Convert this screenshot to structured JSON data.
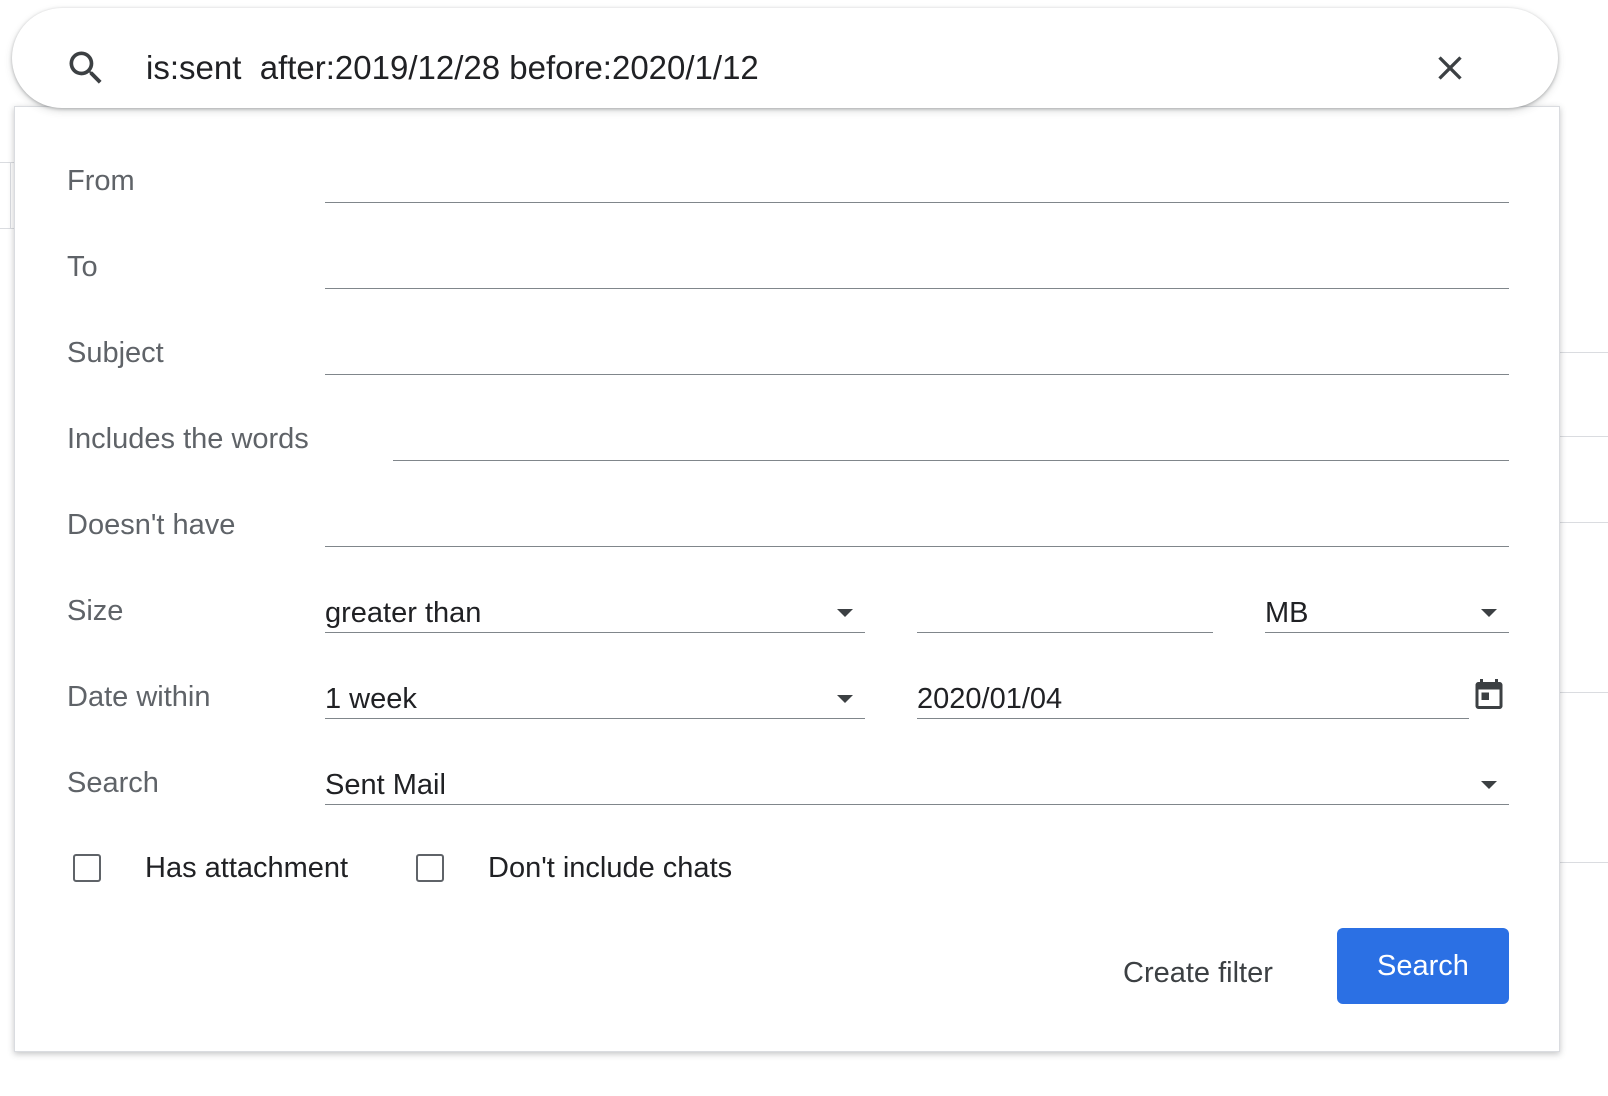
{
  "search": {
    "query": "is:sent  after:2019/12/28 before:2020/1/12",
    "search_icon": "search-icon",
    "clear_icon": "close-icon"
  },
  "form": {
    "from": {
      "label": "From",
      "value": ""
    },
    "to": {
      "label": "To",
      "value": ""
    },
    "subject": {
      "label": "Subject",
      "value": ""
    },
    "includes": {
      "label": "Includes the words",
      "value": ""
    },
    "excludes": {
      "label": "Doesn't have",
      "value": ""
    },
    "size": {
      "label": "Size",
      "operator": "greater than",
      "amount": "",
      "unit": "MB"
    },
    "date_within": {
      "label": "Date within",
      "range": "1 week",
      "date": "2020/01/04",
      "calendar_icon": "calendar-icon"
    },
    "search_in": {
      "label": "Search",
      "value": "Sent Mail"
    },
    "has_attachment": {
      "label": "Has attachment",
      "checked": false
    },
    "exclude_chats": {
      "label": "Don't include chats",
      "checked": false
    }
  },
  "actions": {
    "create_filter": "Create filter",
    "search": "Search"
  },
  "colors": {
    "primary": "#2b70e4",
    "label": "#5f6368",
    "text": "#202124",
    "underline": "#80868b"
  }
}
